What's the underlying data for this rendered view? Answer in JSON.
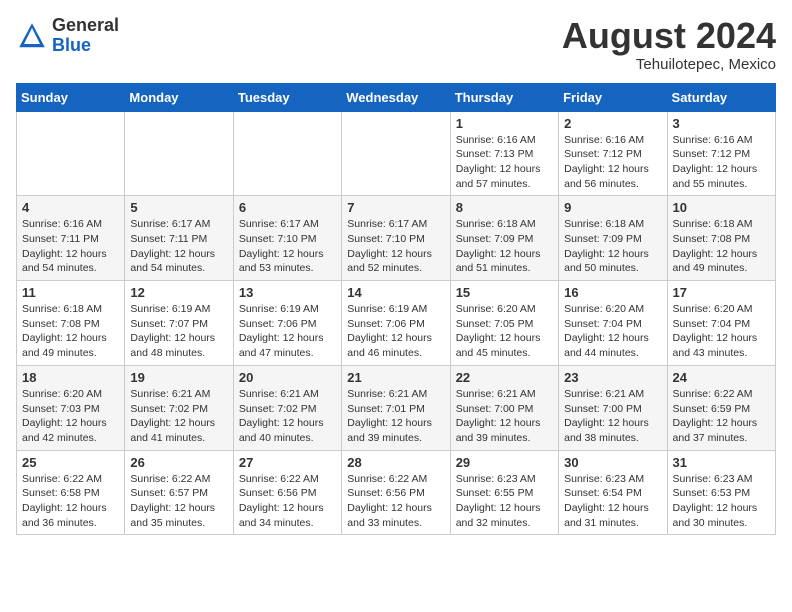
{
  "header": {
    "logo_general": "General",
    "logo_blue": "Blue",
    "month_year": "August 2024",
    "location": "Tehuilotepec, Mexico"
  },
  "calendar": {
    "weekdays": [
      "Sunday",
      "Monday",
      "Tuesday",
      "Wednesday",
      "Thursday",
      "Friday",
      "Saturday"
    ],
    "weeks": [
      [
        {
          "day": "",
          "info": ""
        },
        {
          "day": "",
          "info": ""
        },
        {
          "day": "",
          "info": ""
        },
        {
          "day": "",
          "info": ""
        },
        {
          "day": "1",
          "info": "Sunrise: 6:16 AM\nSunset: 7:13 PM\nDaylight: 12 hours\nand 57 minutes."
        },
        {
          "day": "2",
          "info": "Sunrise: 6:16 AM\nSunset: 7:12 PM\nDaylight: 12 hours\nand 56 minutes."
        },
        {
          "day": "3",
          "info": "Sunrise: 6:16 AM\nSunset: 7:12 PM\nDaylight: 12 hours\nand 55 minutes."
        }
      ],
      [
        {
          "day": "4",
          "info": "Sunrise: 6:16 AM\nSunset: 7:11 PM\nDaylight: 12 hours\nand 54 minutes."
        },
        {
          "day": "5",
          "info": "Sunrise: 6:17 AM\nSunset: 7:11 PM\nDaylight: 12 hours\nand 54 minutes."
        },
        {
          "day": "6",
          "info": "Sunrise: 6:17 AM\nSunset: 7:10 PM\nDaylight: 12 hours\nand 53 minutes."
        },
        {
          "day": "7",
          "info": "Sunrise: 6:17 AM\nSunset: 7:10 PM\nDaylight: 12 hours\nand 52 minutes."
        },
        {
          "day": "8",
          "info": "Sunrise: 6:18 AM\nSunset: 7:09 PM\nDaylight: 12 hours\nand 51 minutes."
        },
        {
          "day": "9",
          "info": "Sunrise: 6:18 AM\nSunset: 7:09 PM\nDaylight: 12 hours\nand 50 minutes."
        },
        {
          "day": "10",
          "info": "Sunrise: 6:18 AM\nSunset: 7:08 PM\nDaylight: 12 hours\nand 49 minutes."
        }
      ],
      [
        {
          "day": "11",
          "info": "Sunrise: 6:18 AM\nSunset: 7:08 PM\nDaylight: 12 hours\nand 49 minutes."
        },
        {
          "day": "12",
          "info": "Sunrise: 6:19 AM\nSunset: 7:07 PM\nDaylight: 12 hours\nand 48 minutes."
        },
        {
          "day": "13",
          "info": "Sunrise: 6:19 AM\nSunset: 7:06 PM\nDaylight: 12 hours\nand 47 minutes."
        },
        {
          "day": "14",
          "info": "Sunrise: 6:19 AM\nSunset: 7:06 PM\nDaylight: 12 hours\nand 46 minutes."
        },
        {
          "day": "15",
          "info": "Sunrise: 6:20 AM\nSunset: 7:05 PM\nDaylight: 12 hours\nand 45 minutes."
        },
        {
          "day": "16",
          "info": "Sunrise: 6:20 AM\nSunset: 7:04 PM\nDaylight: 12 hours\nand 44 minutes."
        },
        {
          "day": "17",
          "info": "Sunrise: 6:20 AM\nSunset: 7:04 PM\nDaylight: 12 hours\nand 43 minutes."
        }
      ],
      [
        {
          "day": "18",
          "info": "Sunrise: 6:20 AM\nSunset: 7:03 PM\nDaylight: 12 hours\nand 42 minutes."
        },
        {
          "day": "19",
          "info": "Sunrise: 6:21 AM\nSunset: 7:02 PM\nDaylight: 12 hours\nand 41 minutes."
        },
        {
          "day": "20",
          "info": "Sunrise: 6:21 AM\nSunset: 7:02 PM\nDaylight: 12 hours\nand 40 minutes."
        },
        {
          "day": "21",
          "info": "Sunrise: 6:21 AM\nSunset: 7:01 PM\nDaylight: 12 hours\nand 39 minutes."
        },
        {
          "day": "22",
          "info": "Sunrise: 6:21 AM\nSunset: 7:00 PM\nDaylight: 12 hours\nand 39 minutes."
        },
        {
          "day": "23",
          "info": "Sunrise: 6:21 AM\nSunset: 7:00 PM\nDaylight: 12 hours\nand 38 minutes."
        },
        {
          "day": "24",
          "info": "Sunrise: 6:22 AM\nSunset: 6:59 PM\nDaylight: 12 hours\nand 37 minutes."
        }
      ],
      [
        {
          "day": "25",
          "info": "Sunrise: 6:22 AM\nSunset: 6:58 PM\nDaylight: 12 hours\nand 36 minutes."
        },
        {
          "day": "26",
          "info": "Sunrise: 6:22 AM\nSunset: 6:57 PM\nDaylight: 12 hours\nand 35 minutes."
        },
        {
          "day": "27",
          "info": "Sunrise: 6:22 AM\nSunset: 6:56 PM\nDaylight: 12 hours\nand 34 minutes."
        },
        {
          "day": "28",
          "info": "Sunrise: 6:22 AM\nSunset: 6:56 PM\nDaylight: 12 hours\nand 33 minutes."
        },
        {
          "day": "29",
          "info": "Sunrise: 6:23 AM\nSunset: 6:55 PM\nDaylight: 12 hours\nand 32 minutes."
        },
        {
          "day": "30",
          "info": "Sunrise: 6:23 AM\nSunset: 6:54 PM\nDaylight: 12 hours\nand 31 minutes."
        },
        {
          "day": "31",
          "info": "Sunrise: 6:23 AM\nSunset: 6:53 PM\nDaylight: 12 hours\nand 30 minutes."
        }
      ]
    ]
  }
}
